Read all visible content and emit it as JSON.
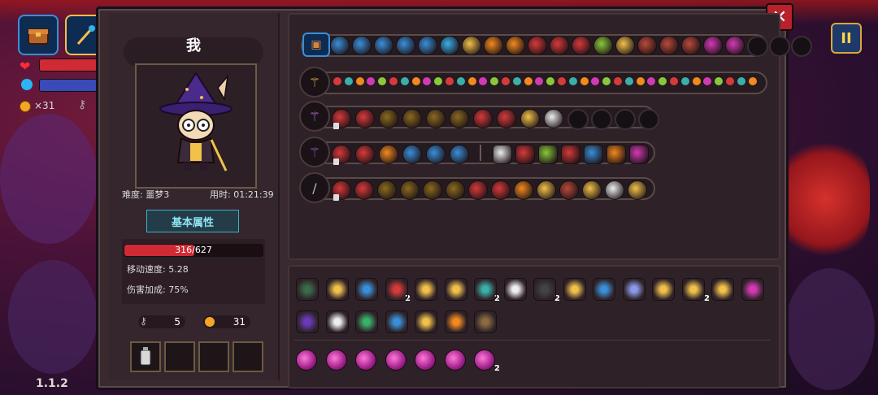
{
  "hud": {
    "coins": "×31",
    "version": "1.1.2"
  },
  "buttons": {
    "close": "✕",
    "pause": "II"
  },
  "player": {
    "name": "我",
    "difficulty_label": "难度: 噩梦3",
    "time_label": "用时: 01:21:39",
    "attributes_button": "基本属性",
    "hp": "316/627",
    "hp_fraction": 0.504,
    "move_speed": "移动速度: 5.28",
    "damage_bonus": "伤害加成: 75%",
    "keys": "5",
    "coins": "31"
  },
  "colors": {
    "gold": "#f2c14a",
    "red": "#d63a3a",
    "blue": "#3a8fd8",
    "magenta": "#d23ab4",
    "orange": "#f28a1e",
    "teal": "#3ab0a8"
  },
  "item_badges": {
    "b1": "2",
    "b2": "2",
    "b3": "2",
    "b4": "2",
    "b5": "2"
  }
}
